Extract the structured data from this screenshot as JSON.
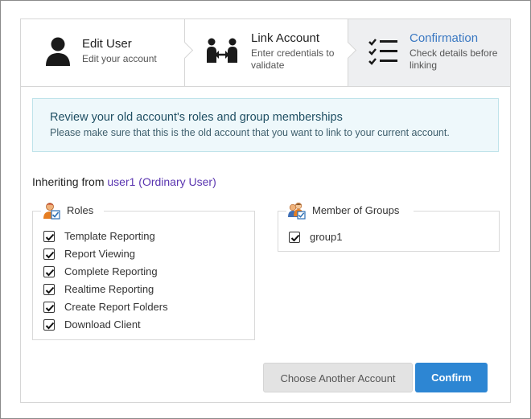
{
  "steps": [
    {
      "title": "Edit User",
      "subtitle": "Edit your account",
      "icon": "user-icon",
      "active": false
    },
    {
      "title": "Link Account",
      "subtitle": "Enter credentials to validate",
      "icon": "link-users-icon",
      "active": false
    },
    {
      "title": "Confirmation",
      "subtitle": "Check details before linking",
      "icon": "checklist-icon",
      "active": true
    }
  ],
  "info": {
    "title": "Review your old account's roles and group memberships",
    "text": "Please make sure that this is the old account that you want to link to your current account."
  },
  "inherit": {
    "label": "Inheriting from",
    "user": "user1 (Ordinary User)"
  },
  "roles": {
    "legend": "Roles",
    "icon": "user-role-icon",
    "items": [
      {
        "label": "Template Reporting",
        "checked": true
      },
      {
        "label": "Report Viewing",
        "checked": true
      },
      {
        "label": "Complete Reporting",
        "checked": true
      },
      {
        "label": "Realtime Reporting",
        "checked": true
      },
      {
        "label": "Create Report Folders",
        "checked": true
      },
      {
        "label": "Download Client",
        "checked": true
      }
    ]
  },
  "groups": {
    "legend": "Member of Groups",
    "icon": "user-group-icon",
    "items": [
      {
        "label": "group1",
        "checked": true
      }
    ]
  },
  "buttons": {
    "secondary": "Choose Another Account",
    "primary": "Confirm"
  },
  "colors": {
    "accent": "#2d86d3",
    "active_step": "#3a78c2",
    "user_link": "#5a35b0",
    "info_bg": "#eef8fb"
  }
}
